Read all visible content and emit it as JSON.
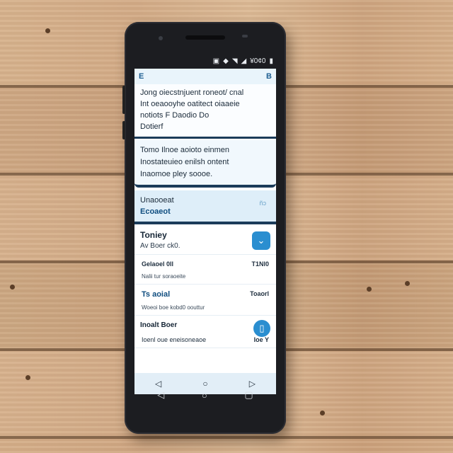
{
  "status": {
    "icons": [
      "sim-icon",
      "wifi-icon",
      "signal-icon",
      "cell-icon",
      "battery-icon"
    ],
    "label": "¥0¢0"
  },
  "screen": {
    "top_left": "E",
    "top_right": "B",
    "card_a": [
      "Jong oiecstnjuent roneot/ cnal",
      "Int oeaooyhe oatitect oiaaeie",
      "notiots F Daodio Do",
      "Dotierf"
    ],
    "card_b": [
      "Tomo Ilnoe aoioto einmen",
      "Inostateuieo enilsh ontent",
      "Inaomoe pley soooe."
    ],
    "card_c": {
      "line1": "Unaooeat",
      "line2": "Ecoaeot",
      "mark": "ñɔ"
    },
    "section1": {
      "title": "Toniey",
      "sub": "Av Boer ck0.",
      "button": "⌄"
    },
    "row1": {
      "left": "Gelaoel 0ll",
      "right": "T1Nl0"
    },
    "row1_sub": "Nalii tur soraoeite",
    "section2": {
      "title": "Ts aoial",
      "right": "Toaorl"
    },
    "row2_sub": "Woeoi boe kobd0 oouttur",
    "section3": {
      "title": "Inoalt Boer",
      "button": "▯"
    },
    "row3": {
      "left": "Ioenl oue eneisoneaoe",
      "right": "Ioe Y"
    },
    "nav": {
      "back": "◁",
      "home": "○",
      "recent": "▷"
    }
  },
  "hardware_nav": {
    "back": "◁",
    "home": "○",
    "recent": "▢"
  }
}
